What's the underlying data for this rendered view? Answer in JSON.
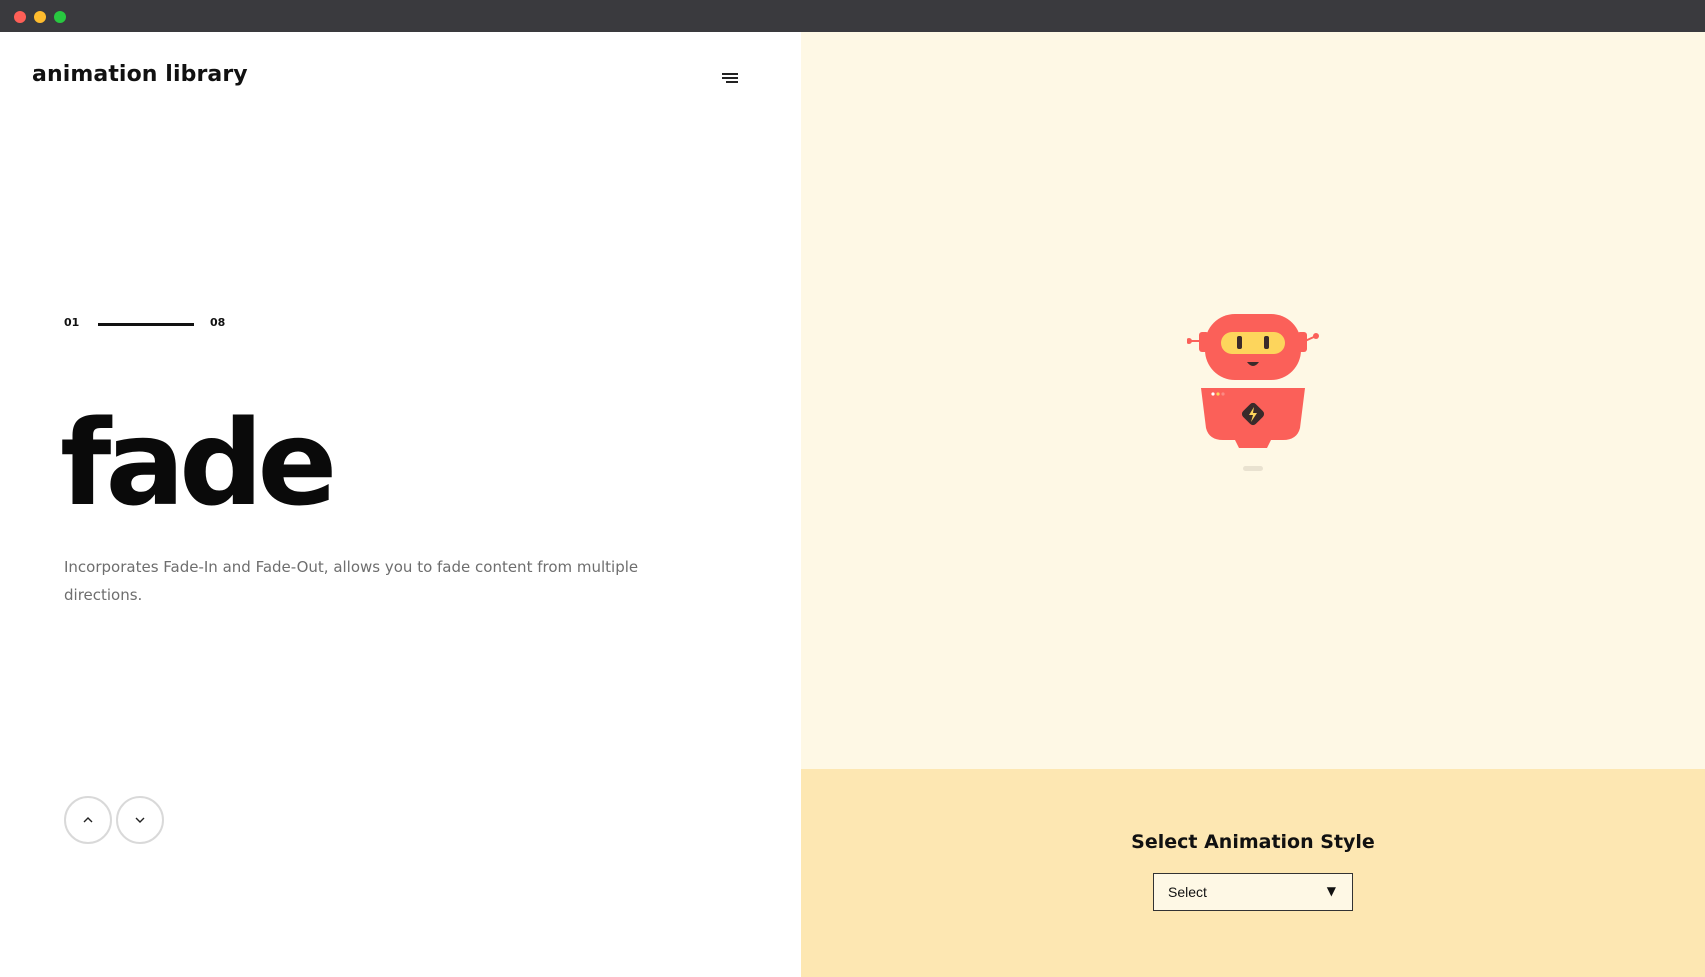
{
  "app": {
    "brand": "animation library"
  },
  "slide": {
    "current": "01",
    "total": "08",
    "title": "fade",
    "description": "Incorporates Fade-In and Fade-Out, allows you to fade content from multiple directions."
  },
  "controls": {
    "menu_icon": "menu-icon",
    "prev_icon": "chevron-up-icon",
    "next_icon": "chevron-down-icon"
  },
  "selector": {
    "title": "Select Animation Style",
    "value": "Select",
    "arrow": "▼"
  },
  "colors": {
    "preview_bg": "#fef8e5",
    "selector_bg": "#fde7b2",
    "robot_body": "#fb6059",
    "robot_visor": "#fdd55c"
  }
}
